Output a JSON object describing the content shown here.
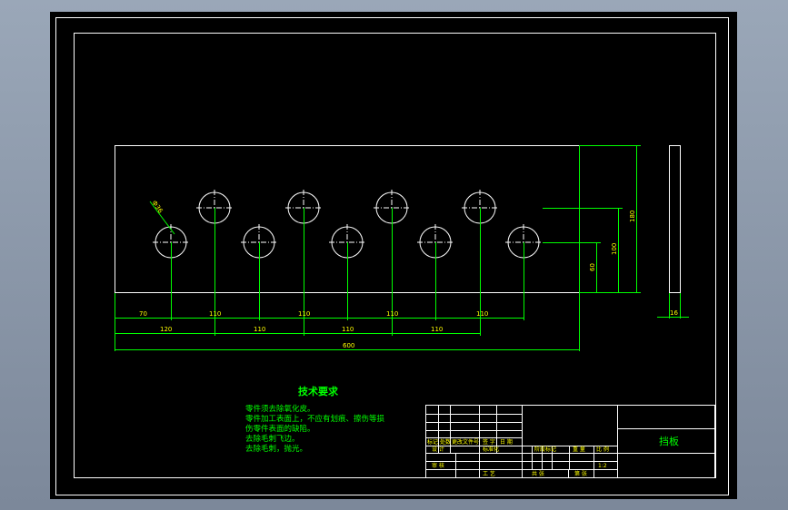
{
  "drawing": {
    "part_name": "挡板",
    "diameter_label": "Ф36",
    "dims": {
      "horizontal_top_row": [
        "70",
        "110",
        "110",
        "110",
        "110",
        "110"
      ],
      "horizontal_mid_row": [
        "120",
        "110",
        "110",
        "110"
      ],
      "overall_length": "600",
      "heights": [
        "60",
        "100",
        "180"
      ],
      "thickness": "16"
    }
  },
  "notes": {
    "title": "技术要求",
    "lines": [
      "零件须去除氧化皮。",
      "零件加工表面上，不应有划痕、擦伤等损",
      "伤零件表面的缺陷。",
      "去除毛刺飞边。",
      "去除毛刺，抛光。"
    ]
  },
  "title_block": {
    "scale": "1:2",
    "cells": [
      "标记",
      "处数",
      "更改文件号",
      "签 字",
      "日 期",
      "设 计",
      "标准化",
      "审 核",
      "工 艺",
      "阶段标记",
      "重 量",
      "比 例",
      "共 张",
      "第 张",
      "批 准"
    ]
  }
}
